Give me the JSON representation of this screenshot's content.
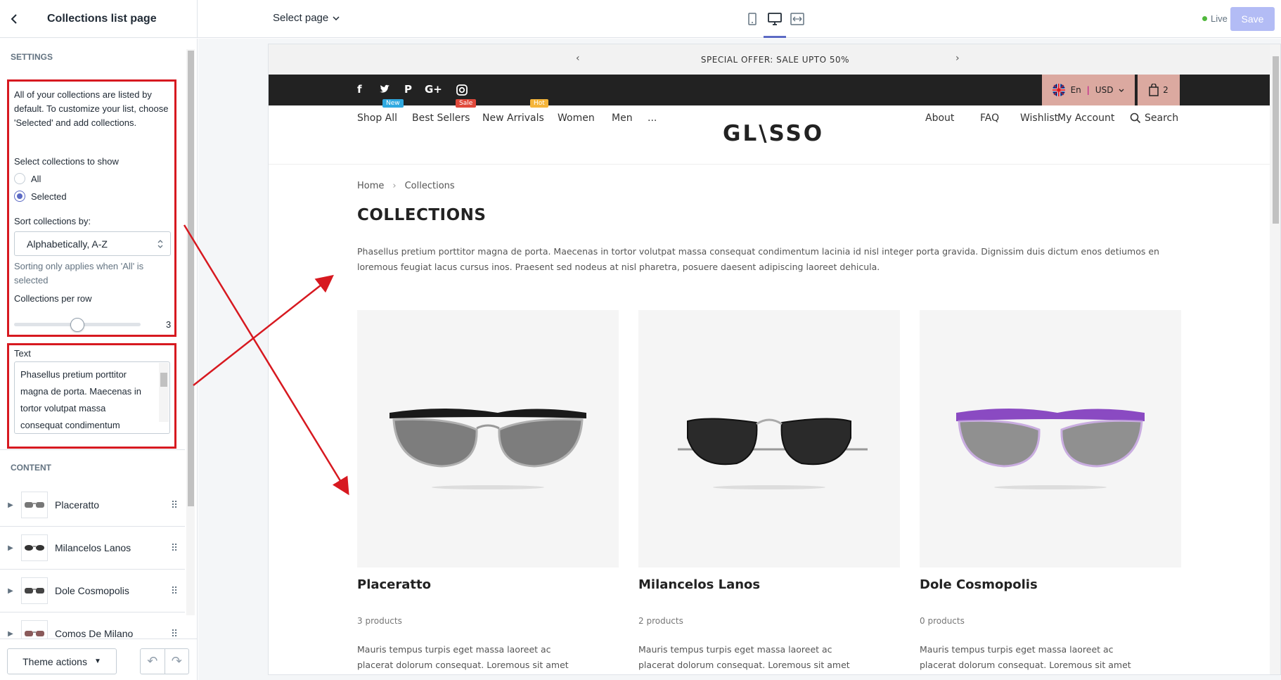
{
  "header": {
    "back_icon": "chevron-left-icon",
    "title": "Collections list page",
    "select_page": "Select page",
    "devices": [
      "mobile-icon",
      "desktop-icon",
      "fullscreen-icon"
    ],
    "live": "Live",
    "save": "Save"
  },
  "sidebar": {
    "settings_heading": "SETTINGS",
    "intro": "All of your collections are listed by default. To customize your list, choose 'Selected' and add collections.",
    "select_label": "Select collections to show",
    "options": [
      "All",
      "Selected"
    ],
    "selected_option": "Selected",
    "sort_label": "Sort collections by:",
    "sort_value": "Alphabetically, A-Z",
    "sort_help": "Sorting only applies when 'All' is selected",
    "per_row_label": "Collections per row",
    "per_row_value": "3",
    "per_row_fraction": 0.5,
    "text_label": "Text",
    "text_value": "Phasellus pretium porttitor magna de porta. Maecenas in tortor volutpat massa consequat condimentum",
    "content_heading": "CONTENT",
    "content_items": [
      "Placeratto",
      "Milancelos Lanos",
      "Dole Cosmopolis",
      "Comos De Milano"
    ],
    "theme_actions": "Theme actions"
  },
  "preview": {
    "announcement": "SPECIAL OFFER: SALE UPTO 50%",
    "lang": "En",
    "currency": "USD",
    "cart_count": "2",
    "nav_left": [
      "Shop All",
      "Best Sellers",
      "New Arrivals",
      "Women",
      "Men",
      "..."
    ],
    "badges": [
      "New",
      "Sale",
      "Hot"
    ],
    "badge_colors": [
      "#2fa9e0",
      "#e0493b",
      "#f5b53a"
    ],
    "logo": "GL\\SSO",
    "nav_right": [
      "About",
      "FAQ",
      "Wishlist",
      "My Account",
      "Search"
    ],
    "breadcrumb": [
      "Home",
      "Collections"
    ],
    "title": "COLLECTIONS",
    "description": "Phasellus pretium porttitor magna de porta. Maecenas in tortor volutpat massa consequat condimentum lacinia id nisl integer porta gravida. Dignissim duis dictum enos detiumos en loremous feugiat lacus cursus inos. Praesent sed nodeus at nisl pharetra, posuere daesent adipiscing laoreet dehicula.",
    "collections": [
      {
        "title": "Placeratto",
        "count": "3 products",
        "desc": "Mauris tempus turpis eget massa laoreet ac placerat dolorum consequat. Loremous sit amet eros justo del"
      },
      {
        "title": "Milancelos Lanos",
        "count": "2 products",
        "desc": "Mauris tempus turpis eget massa laoreet ac placerat dolorum consequat. Loremous sit amet eros justo del"
      },
      {
        "title": "Dole Cosmopolis",
        "count": "0 products",
        "desc": "Mauris tempus turpis eget massa laoreet ac placerat dolorum consequat. Loremous sit amet eros justo del"
      }
    ]
  },
  "colors": {
    "accent": "#5c6ac4",
    "annotation_red": "#d71920",
    "save_disabled": "#b3bcf5",
    "live_dot": "#50b83c",
    "top_bar_dark": "#222222",
    "lang_bg": "#dba9a0"
  }
}
